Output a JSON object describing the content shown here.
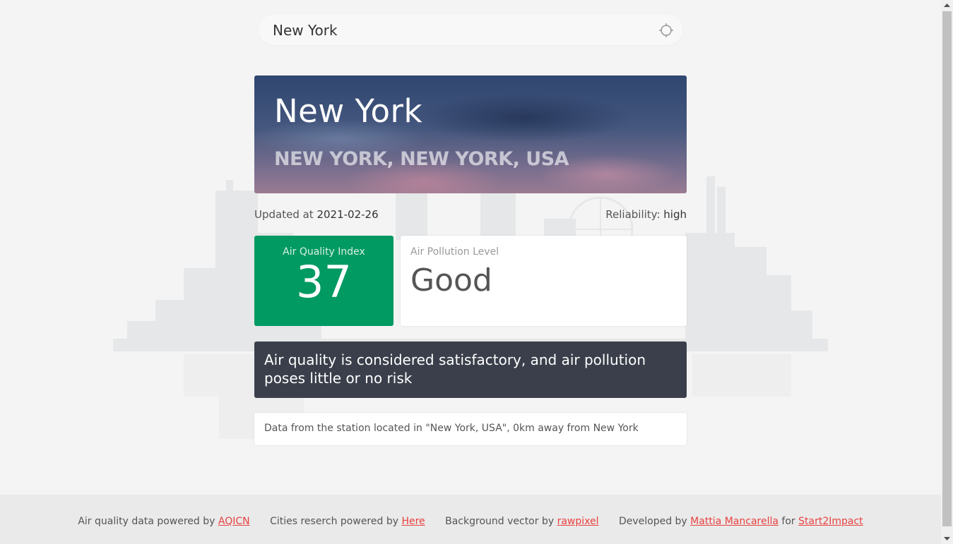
{
  "search": {
    "value": "New York"
  },
  "hero": {
    "city": "New York",
    "location": "NEW YORK, NEW YORK, USA"
  },
  "meta": {
    "updated_label": "Updated at",
    "updated_date": "2021-02-26",
    "reliability_label": "Reliability:",
    "reliability_value": "high"
  },
  "aqi": {
    "label": "Air Quality Index",
    "value": "37",
    "color": "#009a62"
  },
  "pollution": {
    "label": "Air Pollution Level",
    "value": "Good"
  },
  "description": "Air quality is considered satisfactory, and air pollution poses little or no risk",
  "station": "Data from the station located in \"New York, USA\", 0km away from New York",
  "footer": {
    "aqicn_prefix": "Air quality data powered by",
    "aqicn_link": "AQICN",
    "here_prefix": "Cities reserch powered by",
    "here_link": "Here",
    "vector_prefix": "Background vector by",
    "vector_link": "rawpixel",
    "dev_prefix": "Developed by",
    "dev_link": "Mattia Mancarella",
    "dev_for": "for",
    "org_link": "Start2Impact"
  },
  "colors": {
    "link": "#e8413f",
    "description_bg": "#3a3f4b"
  },
  "icons": {
    "locate": "crosshair-icon"
  }
}
